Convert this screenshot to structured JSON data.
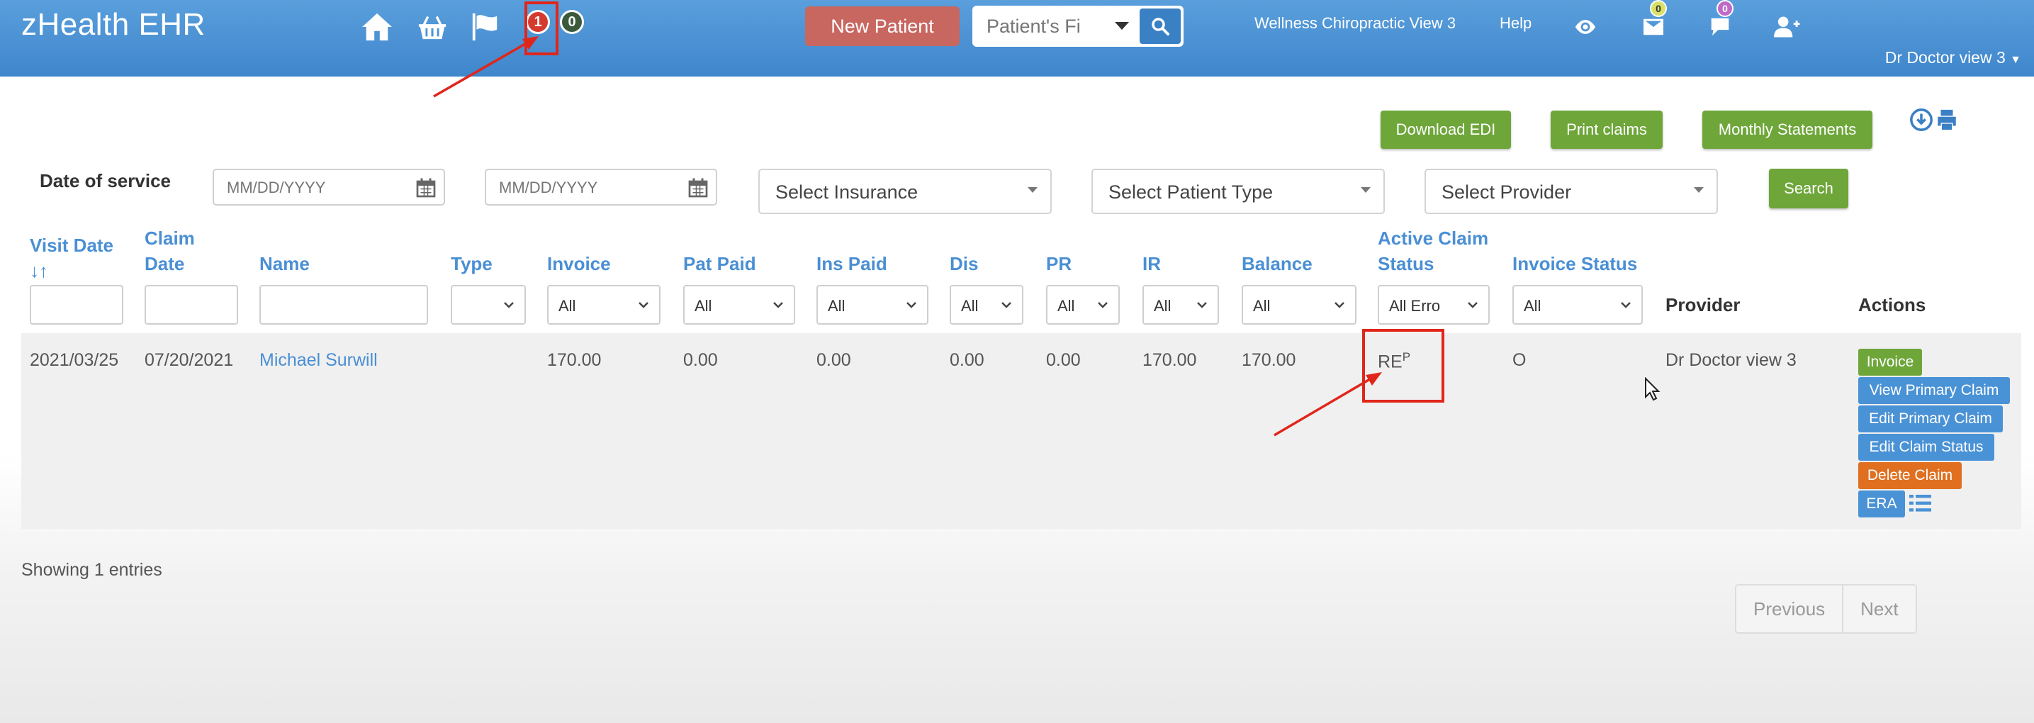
{
  "navbar": {
    "brand": "zHealth EHR",
    "alert_count_red": "1",
    "alert_count_dark": "0",
    "new_patient_label": "New Patient",
    "search_placeholder": "Patient's Fi",
    "clinic_name": "Wellness Chiropractic View 3",
    "help_label": "Help",
    "messages_badge": "0",
    "chat_badge": "0",
    "user_name": "Dr Doctor view 3",
    "icons": [
      "home-icon",
      "basket-icon",
      "flag-icon",
      "eye-icon",
      "inbox-icon",
      "chat-icon",
      "add-user-icon"
    ]
  },
  "toolbar": {
    "download_edi": "Download EDI",
    "print_claims": "Print claims",
    "monthly_statements": "Monthly Statements",
    "search_label": "Search"
  },
  "filters": {
    "date_of_service_label": "Date of service",
    "date_from_placeholder": "MM/DD/YYYY",
    "date_to_placeholder": "MM/DD/YYYY",
    "insurance": "Select Insurance",
    "patient_type": "Select Patient Type",
    "provider": "Select Provider"
  },
  "table": {
    "columns": {
      "visit_date": "Visit Date",
      "claim_date_1": "Claim",
      "claim_date_2": "Date",
      "name": "Name",
      "type": "Type",
      "invoice": "Invoice",
      "pat_paid": "Pat Paid",
      "ins_paid": "Ins Paid",
      "dis": "Dis",
      "pr": "PR",
      "ir": "IR",
      "balance": "Balance",
      "active_claim_status_1": "Active Claim",
      "active_claim_status_2": "Status",
      "invoice_status": "Invoice Status",
      "provider": "Provider",
      "actions": "Actions"
    },
    "column_filters": {
      "type": "",
      "invoice": "All",
      "pat_paid": "All",
      "ins_paid": "All",
      "dis": "All",
      "pr": "All",
      "ir": "All",
      "balance": "All",
      "active_claim_status": "All Erro",
      "invoice_status": "All"
    },
    "rows": [
      {
        "visit_date": "2021/03/25",
        "claim_date": "07/20/2021",
        "name": "Michael Surwill",
        "type": "",
        "invoice": "170.00",
        "pat_paid": "0.00",
        "ins_paid": "0.00",
        "dis": "0.00",
        "pr": "0.00",
        "ir": "170.00",
        "balance": "170.00",
        "claim_status": "RE",
        "claim_status_sup": "P",
        "invoice_status": "O",
        "provider": "Dr Doctor view 3",
        "actions": {
          "invoice": "Invoice",
          "view_primary": "View Primary Claim",
          "edit_primary": "Edit Primary Claim",
          "edit_status": "Edit Claim Status",
          "delete": "Delete Claim",
          "era": "ERA"
        }
      }
    ]
  },
  "footer": {
    "showing": "Showing 1 entries",
    "previous": "Previous",
    "next": "Next"
  },
  "colors": {
    "navbar": "#4a90d6",
    "new_patient": "#c86660",
    "green_button": "#6ea63a",
    "blue_button": "#4a92d6",
    "orange_button": "#e07020",
    "annotation_red": "#e0261b"
  }
}
